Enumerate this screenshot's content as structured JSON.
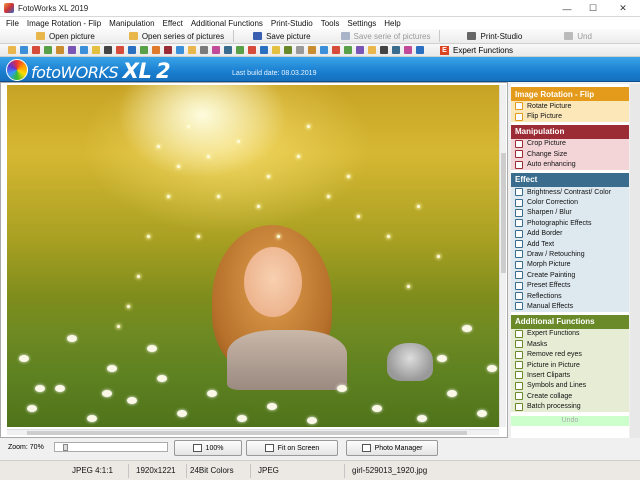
{
  "window": {
    "title": "FotoWorks XL 2019"
  },
  "window_controls": {
    "minimize": "—",
    "maximize": "☐",
    "close": "✕"
  },
  "menu": [
    "File",
    "Image Rotation - Flip",
    "Manipulation",
    "Effect",
    "Additional Functions",
    "Print-Studio",
    "Tools",
    "Settings",
    "Help"
  ],
  "quickbar": {
    "open_picture": "Open picture",
    "open_series": "Open series of pictures",
    "save_picture": "Save picture",
    "save_series": "Save serie of pictures",
    "print_studio": "Print-Studio",
    "undo": "Und"
  },
  "iconbar": {
    "expert_badge": "E",
    "expert_label": "Expert Functions",
    "tool_colors": [
      "#e8b64a",
      "#3a8fd8",
      "#d64b3a",
      "#5aa048",
      "#c98c2e",
      "#7a55b8",
      "#3a8fd8",
      "#e3c040",
      "#444444",
      "#d64b3a",
      "#2b6fc0",
      "#5aa048",
      "#e07a2a",
      "#9b2b35",
      "#3a8fd8",
      "#e8b64a",
      "#7a7a7a",
      "#c24a9a",
      "#3a6d8d",
      "#5aa048",
      "#d64b3a",
      "#2b6fc0",
      "#e3c040",
      "#6a8a2a",
      "#999999",
      "#c98c2e",
      "#3a8fd8",
      "#d64b3a",
      "#5aa048",
      "#7a55b8",
      "#e8b64a",
      "#444444",
      "#3a6d8d",
      "#c24a9a",
      "#2b6fc0"
    ]
  },
  "banner": {
    "logo_prefix": "foto",
    "logo_main": "WORKS",
    "logo_xl": "XL",
    "logo_num": "2",
    "build_date": "Last build date: 08.03.2019"
  },
  "panel": {
    "sections": [
      {
        "key": "rot",
        "title": "Image Rotation - Flip",
        "color": "#e49a1a",
        "items": [
          "Rotate Picture",
          "Flip Picture"
        ]
      },
      {
        "key": "man",
        "title": "Manipulation",
        "color": "#9b2b35",
        "items": [
          "Crop Picture",
          "Change Size",
          "Auto enhancing"
        ]
      },
      {
        "key": "eff",
        "title": "Effect",
        "color": "#3a6d8d",
        "items": [
          "Brightness/ Contrast/ Color",
          "Color Correction",
          "Sharpen / Blur",
          "Photographic Effects",
          "Add Border",
          "Add Text",
          "Draw / Retouching",
          "Morph Picture",
          "Create Painting",
          "Preset Effects",
          "Reflections",
          "Manual Effects"
        ]
      },
      {
        "key": "add",
        "title": "Additional Functions",
        "color": "#6a8a2a",
        "items": [
          "Expert Functions",
          "Masks",
          "Remove red eyes",
          "Picture in Picture",
          "Insert Cliparts",
          "Symbols and Lines",
          "Create collage",
          "Batch processing"
        ]
      }
    ],
    "undo": "Undo"
  },
  "zoom": {
    "label": "Zoom: 70%",
    "level_percent": 70,
    "btn_100": "100%",
    "btn_fit": "Fit on Screen",
    "btn_manager": "Photo Manager"
  },
  "status": {
    "format": "JPEG  4:1:1",
    "size": "1920x1221",
    "colors": "24Bit Colors",
    "type": "JPEG",
    "filename": "girl-529013_1920.jpg"
  }
}
